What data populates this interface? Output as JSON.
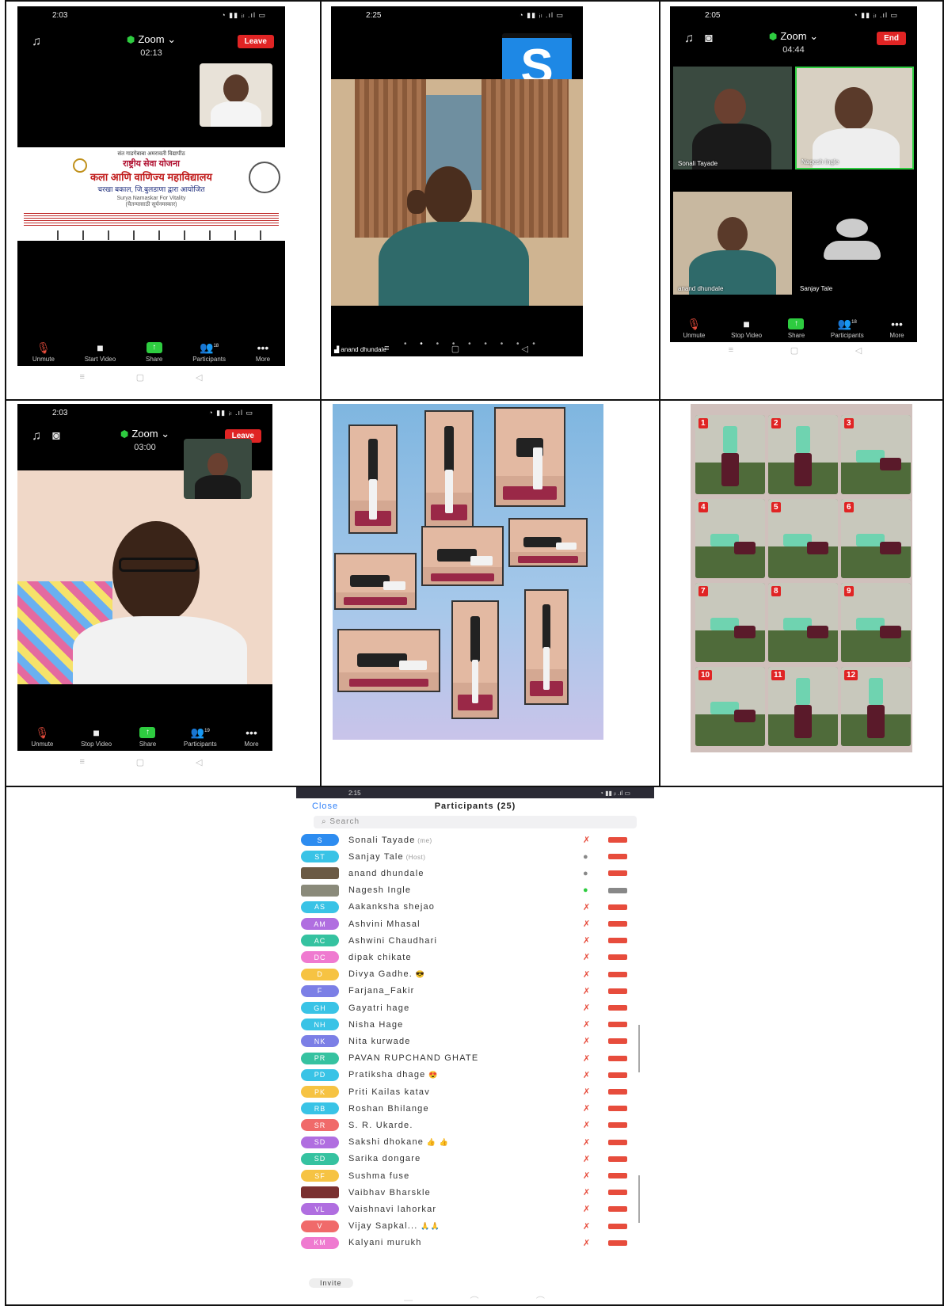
{
  "screen1": {
    "clock": "2:03",
    "app": "Zoom",
    "timer": "02:13",
    "leave": "Leave",
    "poster": {
      "line1": "संत गाडगेबाबा    अमरावती विद्यापीठ",
      "line2": "राष्ट्रीय सेवा योजना",
      "line3": "कला आणि वाणिज्य महाविद्यालय",
      "line4": "चरखा बकाल, जि.बुलडाणा द्वारा आयोजित",
      "line5": "Surya Namaskar For Vitality",
      "line6": "(चैतन्यासाठी सूर्यनमस्कार)"
    },
    "toolbar": {
      "unmute": "Unmute",
      "video": "Start Video",
      "share": "Share",
      "participants": "Participants",
      "count": "18",
      "more": "More"
    }
  },
  "screen2": {
    "clock": "2:25",
    "logo": "S",
    "name": "anand dhundale"
  },
  "screen3": {
    "clock": "2:05",
    "app": "Zoom",
    "timer": "04:44",
    "end": "End",
    "tiles": [
      "Sonali Tayade",
      "Nagesh Ingle",
      "anand dhundale",
      "Sanjay Tale"
    ],
    "toolbar": {
      "unmute": "Unmute",
      "video": "Stop Video",
      "share": "Share",
      "participants": "Participants",
      "count": "18",
      "more": "More"
    }
  },
  "screen4": {
    "clock": "2:03",
    "app": "Zoom",
    "timer": "03:00",
    "leave": "Leave",
    "toolbar": {
      "unmute": "Unmute",
      "video": "Stop Video",
      "share": "Share",
      "participants": "Participants",
      "count": "19",
      "more": "More"
    }
  },
  "collage2_numbers": [
    "1",
    "2",
    "3",
    "4",
    "5",
    "6",
    "7",
    "8",
    "9",
    "10",
    "11",
    "12"
  ],
  "participants": {
    "clock": "2:15",
    "close": "Close",
    "title": "Participants (25)",
    "search": "Search",
    "invite": "Invite",
    "me_tag": "(me)",
    "host_tag": "(Host)",
    "list": [
      {
        "initials": "S",
        "name": "Sonali Tayade",
        "color": "#2d8cf0",
        "tag": "me"
      },
      {
        "initials": "ST",
        "name": "Sanjay Tale",
        "color": "#39c3e6",
        "tag": "host"
      },
      {
        "initials": "",
        "name": "anand dhundale",
        "color": "#6b5a44",
        "pic": true
      },
      {
        "initials": "",
        "name": "Nagesh Ingle",
        "color": "#8a8a7a",
        "pic": true
      },
      {
        "initials": "AS",
        "name": "Aakanksha shejao",
        "color": "#39c3e6"
      },
      {
        "initials": "AM",
        "name": "Ashvini Mhasal",
        "color": "#b06ee0"
      },
      {
        "initials": "AC",
        "name": "Ashwini Chaudhari",
        "color": "#35c2a0"
      },
      {
        "initials": "DC",
        "name": "dipak chikate",
        "color": "#ef7ad0"
      },
      {
        "initials": "D",
        "name": "Divya Gadhe.",
        "color": "#f6c343",
        "emoji": "😎"
      },
      {
        "initials": "F",
        "name": "Farjana_Fakir",
        "color": "#7b7fe6"
      },
      {
        "initials": "GH",
        "name": "Gayatri hage",
        "color": "#39c3e6"
      },
      {
        "initials": "NH",
        "name": "Nisha Hage",
        "color": "#39c3e6"
      },
      {
        "initials": "NK",
        "name": "Nita kurwade",
        "color": "#7b7fe6"
      },
      {
        "initials": "PR",
        "name": "PAVAN RUPCHAND GHATE",
        "color": "#35c2a0"
      },
      {
        "initials": "PD",
        "name": "Pratiksha dhage",
        "color": "#39c3e6",
        "emoji": "😍"
      },
      {
        "initials": "PK",
        "name": "Priti Kailas katav",
        "color": "#f6c343"
      },
      {
        "initials": "RB",
        "name": "Roshan Bhilange",
        "color": "#39c3e6"
      },
      {
        "initials": "SR",
        "name": "S. R. Ukarde.",
        "color": "#f06a6a"
      },
      {
        "initials": "SD",
        "name": "Sakshi dhokane",
        "color": "#b06ee0",
        "emoji": "👍 👍"
      },
      {
        "initials": "SD",
        "name": "Sarika dongare",
        "color": "#35c2a0"
      },
      {
        "initials": "SF",
        "name": "Sushma fuse",
        "color": "#f6c343"
      },
      {
        "initials": "",
        "name": "Vaibhav Bharskle",
        "color": "#7a3030",
        "pic": true
      },
      {
        "initials": "VL",
        "name": "Vaishnavi lahorkar",
        "color": "#b06ee0"
      },
      {
        "initials": "V",
        "name": "Vijay Sapkal...",
        "color": "#f06a6a",
        "emoji": "🙏🙏"
      },
      {
        "initials": "KM",
        "name": "Kalyani murukh",
        "color": "#ef7ad0"
      }
    ]
  },
  "colors": {
    "leave": "#e02424",
    "share": "#2ecc40",
    "mic_off": "#e74c3c",
    "link": "#2d7ff9"
  }
}
